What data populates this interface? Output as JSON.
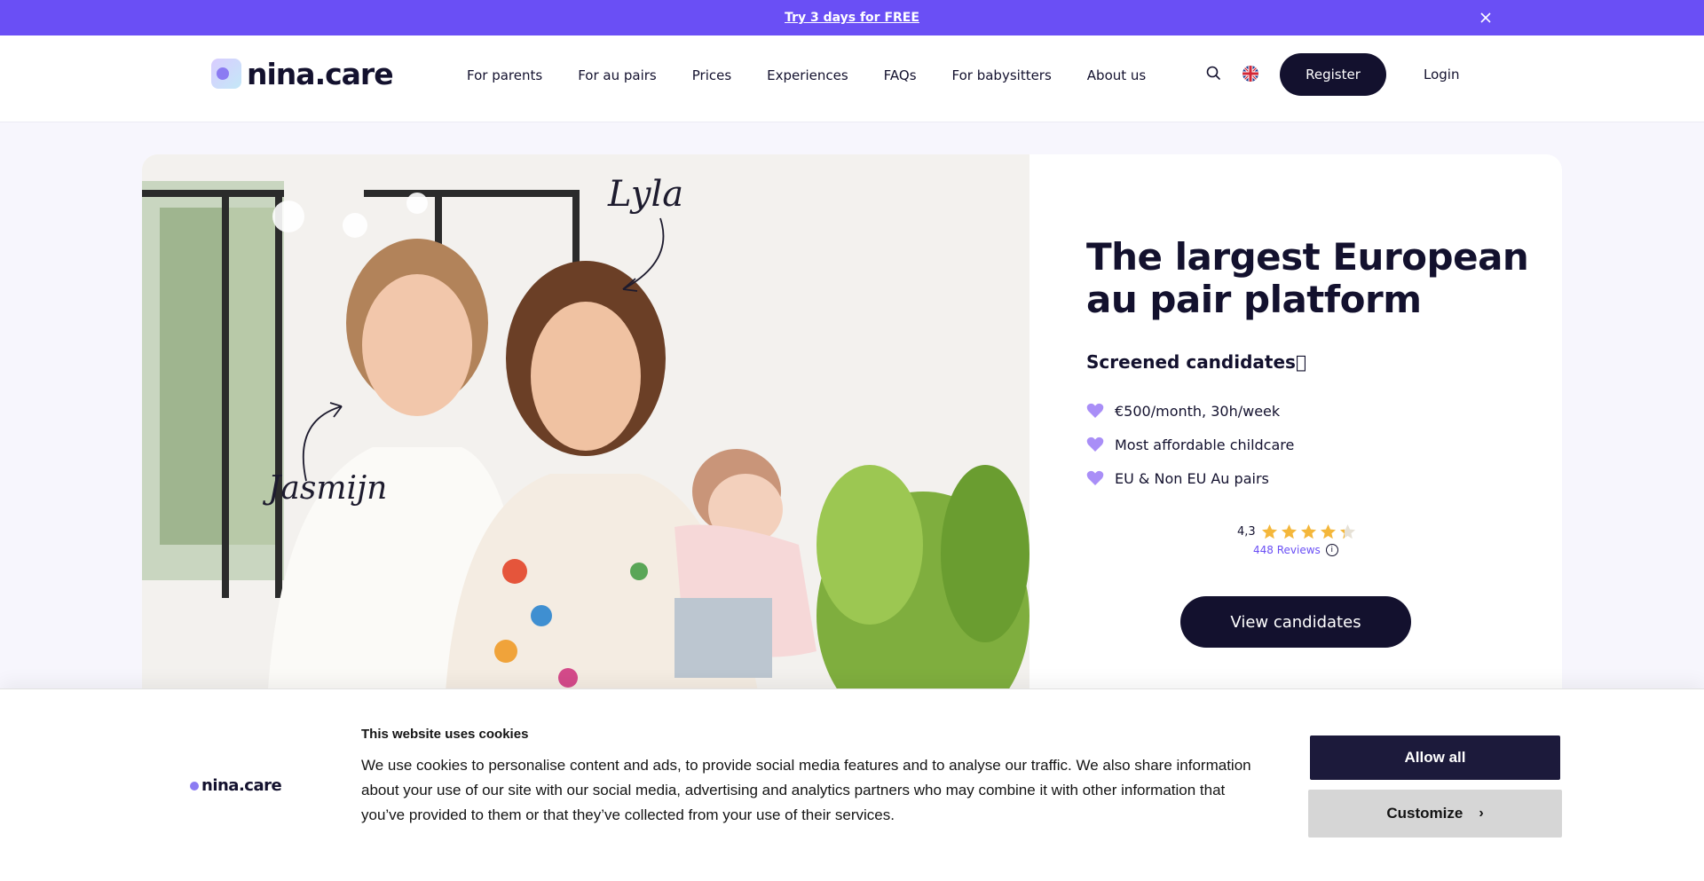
{
  "promo": {
    "link": "Try 3 days for FREE",
    "close_icon": "close-icon"
  },
  "header": {
    "logo_text": "nina.care",
    "nav": [
      "For parents",
      "For au pairs",
      "Prices",
      "Experiences",
      "FAQs",
      "For babysitters",
      "About us"
    ],
    "register": "Register",
    "login": "Login",
    "icons": {
      "search": "search-icon",
      "language": "uk-flag-icon"
    }
  },
  "hero": {
    "photo_labels": {
      "left": "Jasmijn",
      "right": "Lyla"
    },
    "title": "The largest European au pair platform",
    "subtitle": "Screened candidates\u0000",
    "bullets": [
      "€500/month, 30h/week",
      "Most affordable childcare",
      "EU & Non EU Au pairs"
    ],
    "rating": {
      "score": "4,3",
      "stars": 4.3,
      "reviews": "448 Reviews"
    },
    "cta": "View candidates",
    "colors": {
      "accent": "#6a4ff5",
      "heart": "#a98ef7",
      "star": "#f4b73b",
      "dark": "#13112e"
    }
  },
  "cookie": {
    "logo_text": "nina.care",
    "title": "This website uses cookies",
    "text": "We use cookies to personalise content and ads, to provide social media features and to analyse our traffic. We also share information about your use of our site with our social media, advertising and analytics partners who may combine it with other information that you’ve provided to them or that they’ve collected from your use of their services.",
    "allow": "Allow all",
    "customize": "Customize"
  }
}
